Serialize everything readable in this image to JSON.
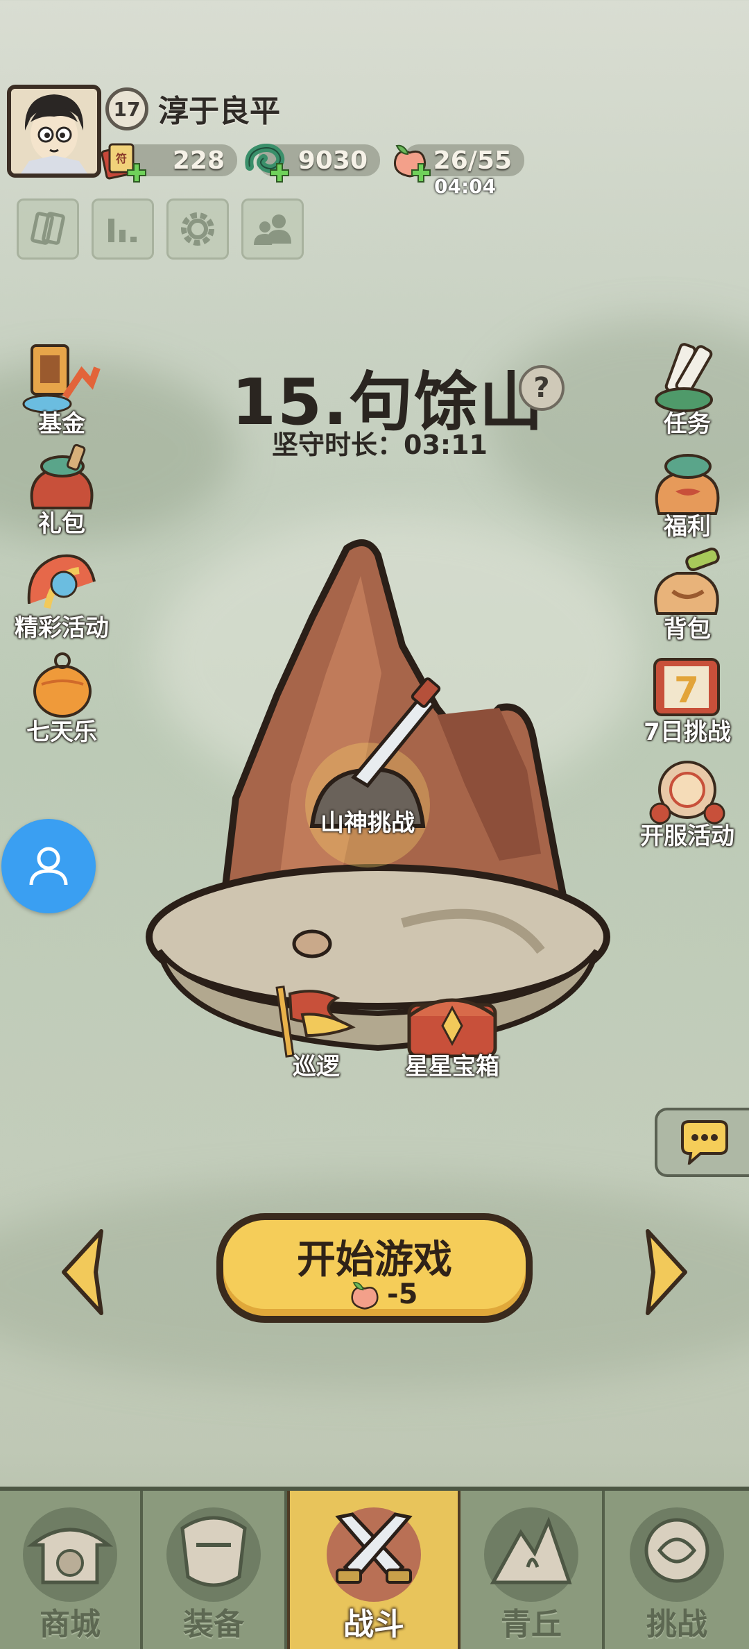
{
  "player": {
    "level": "17",
    "name": "淳于良平"
  },
  "resources": {
    "scrolls": "228",
    "jade": "9030",
    "stamina": "26/55",
    "stamina_timer": "04:04"
  },
  "stage": {
    "title": "15.句馀山",
    "help": "?",
    "guard_time": "坚守时长：03:11"
  },
  "left_menu": [
    {
      "label": "基金",
      "icon": "fund-icon"
    },
    {
      "label": "礼包",
      "icon": "gift-pack-icon"
    },
    {
      "label": "精彩活动",
      "icon": "events-icon"
    },
    {
      "label": "七天乐",
      "icon": "seven-days-icon"
    }
  ],
  "right_menu": [
    {
      "label": "任务",
      "icon": "quest-icon"
    },
    {
      "label": "福利",
      "icon": "welfare-icon"
    },
    {
      "label": "背包",
      "icon": "backpack-icon"
    },
    {
      "label": "7日挑战",
      "icon": "seven-day-challenge-icon"
    },
    {
      "label": "开服活动",
      "icon": "server-opening-icon"
    }
  ],
  "scene": {
    "challenge": "山神挑战",
    "patrol": "巡逻",
    "star_chest": "星星宝箱"
  },
  "start": {
    "label": "开始游戏",
    "cost": "-5"
  },
  "bottom_nav": [
    {
      "label": "商城",
      "icon": "shop-icon"
    },
    {
      "label": "装备",
      "icon": "equipment-icon"
    },
    {
      "label": "战斗",
      "icon": "battle-icon",
      "active": true
    },
    {
      "label": "青丘",
      "icon": "qingqiu-icon"
    },
    {
      "label": "挑战",
      "icon": "challenge-icon"
    }
  ],
  "colors": {
    "accent": "#f5cd59",
    "contact": "#3a9ff2",
    "nav_bg": "#8b9a7d"
  }
}
